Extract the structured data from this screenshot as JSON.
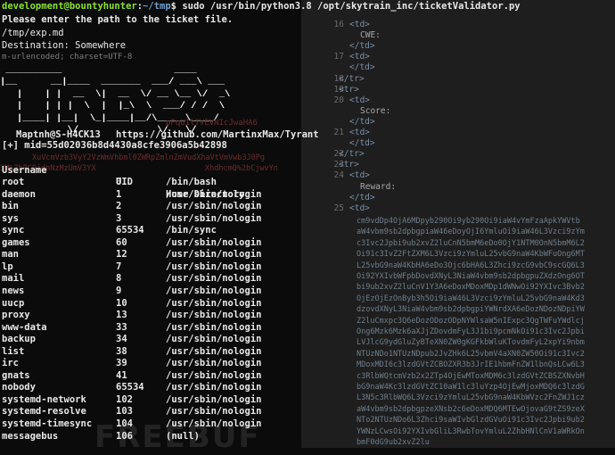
{
  "terminal": {
    "prompt_user": "development@bountyhunter",
    "prompt_sep": ":",
    "prompt_path": "~/tmp",
    "prompt_symbol": "$ ",
    "command": "sudo /usr/bin/python3.8 /opt/skytrain_inc/ticketValidator.py",
    "lines": [
      "Please enter the path to the ticket file.",
      "/tmp/exp.md",
      "Destination: Somewhere"
    ],
    "ghost_line": "m-urlencoded; charset=UTF-8",
    "ascii_art": " __________                    ____     \n|__      __|____  _______  ___/ ___\\ ___\n   |    | |  __  \\|  __  \\/ __ \\__ \\/  _\\\n   |    | | |  \\  |  |_\\  \\  ___/ / /  \\\n   |____| |__|  \\_|____|__/\\_____\\____/\n            \\/              \\/   \\/",
    "ghost_mid": "pPqU1lTVEVNIcJwaHA6",
    "banner_left": "Maptnh@S-H4CK13",
    "banner_right": "https://github.com/MartinxMax/Tyrant",
    "ghost_b64_1": "XuVcmVzb3VyY2VzWmVhbml0ZWRpZmlnZmVudXhaVtVmVwb3J0Pg",
    "ghost_b64_2": "3M%2bPC9jdnNzMzUmV3YX",
    "ghost_b64_3": "XhdhcmQ%2bCjwvYn",
    "mid_line": "[+] mid=55d02036b8d4430a8cfe3906a5b42898",
    "table_header": {
      "user": "Username",
      "uid": "UID",
      "home": "Home Directory"
    },
    "rows": [
      {
        "user": "root",
        "uid": "0",
        "home": "/bin/bash"
      },
      {
        "user": "daemon",
        "uid": "1",
        "home": "/usr/sbin/nologin"
      },
      {
        "user": "bin",
        "uid": "2",
        "home": "/usr/sbin/nologin"
      },
      {
        "user": "sys",
        "uid": "3",
        "home": "/usr/sbin/nologin"
      },
      {
        "user": "sync",
        "uid": "65534",
        "home": "/bin/sync"
      },
      {
        "user": "games",
        "uid": "60",
        "home": "/usr/sbin/nologin"
      },
      {
        "user": "man",
        "uid": "12",
        "home": "/usr/sbin/nologin"
      },
      {
        "user": "lp",
        "uid": "7",
        "home": "/usr/sbin/nologin"
      },
      {
        "user": "mail",
        "uid": "8",
        "home": "/usr/sbin/nologin"
      },
      {
        "user": "news",
        "uid": "9",
        "home": "/usr/sbin/nologin"
      },
      {
        "user": "uucp",
        "uid": "10",
        "home": "/usr/sbin/nologin"
      },
      {
        "user": "proxy",
        "uid": "13",
        "home": "/usr/sbin/nologin"
      },
      {
        "user": "www-data",
        "uid": "33",
        "home": "/usr/sbin/nologin"
      },
      {
        "user": "backup",
        "uid": "34",
        "home": "/usr/sbin/nologin"
      },
      {
        "user": "list",
        "uid": "38",
        "home": "/usr/sbin/nologin"
      },
      {
        "user": "irc",
        "uid": "39",
        "home": "/usr/sbin/nologin"
      },
      {
        "user": "gnats",
        "uid": "41",
        "home": "/usr/sbin/nologin"
      },
      {
        "user": "nobody",
        "uid": "65534",
        "home": "/usr/sbin/nologin"
      },
      {
        "user": "systemd-network",
        "uid": "102",
        "home": "/usr/sbin/nologin"
      },
      {
        "user": "systemd-resolve",
        "uid": "103",
        "home": "/usr/sbin/nologin"
      },
      {
        "user": "systemd-timesync",
        "uid": "104",
        "home": "/usr/sbin/nologin"
      },
      {
        "user": "messagebus",
        "uid": "106",
        "home": "(null)"
      }
    ],
    "watermark": "FREEBUF"
  },
  "code_view": {
    "lines": [
      {
        "num": "16",
        "text": "<td>"
      },
      {
        "num": "",
        "text": "CWE:"
      },
      {
        "num": "",
        "text": "</td>"
      },
      {
        "num": "17",
        "text": "<td>"
      },
      {
        "num": "",
        "text": "</td>"
      },
      {
        "num": "18",
        "text": "</tr>"
      },
      {
        "num": "19",
        "text": "<tr>"
      },
      {
        "num": "20",
        "text": "<td>"
      },
      {
        "num": "",
        "text": "Score:"
      },
      {
        "num": "",
        "text": "</td>"
      },
      {
        "num": "21",
        "text": "<td>"
      },
      {
        "num": "",
        "text": "</td>"
      },
      {
        "num": "22",
        "text": "</tr>"
      },
      {
        "num": "23",
        "text": "<tr>"
      },
      {
        "num": "24",
        "text": "<td>"
      },
      {
        "num": "",
        "text": "Reward:"
      },
      {
        "num": "",
        "text": "</td>"
      },
      {
        "num": "25",
        "text": "<td>"
      }
    ],
    "b64_lines": [
      "cm9vdDp4OjA6MDpyb290Oi9yb290Oi9iaW4vYmFzaApkYWVtb",
      "aW4vbm9sb2dpbgpiaW46eDoyOjI6YmluOi9iaW46L3Vzci9zYm",
      "c3Ivc2Jpbi9ub2xvZ2luCnN5bmM6eDo0OjY1NTM0OnN5bmM6L2",
      "Oi91c3IvZ2FtZXM6L3Vzci9zYmluL25vbG9naW4KbWFuOng6MT",
      "L25vbG9naW4KbHA6eDo3Ojc6bHA6L3Zhci9zcG9vbC9scGQ6L3",
      "Oi92YXIvbWFpbDovdXNyL3NiaW4vbm9sb2dpbgpuZXdzOng6OT",
      "bi9ub2xvZ2luCnV1Y3A6eDoxMDoxMDp1dWNwOi92YXIvc3Bvb2",
      "OjEzOjEzOnByb3h5Oi9iaW46L3Vzci9zYmluL25vbG9naW4Kd3",
      "dzovdXNyL3NiaW4vbm9sb2dpbgpiYWNrdXA6eDozNDozNDpiYW",
      "Z2luCmxpc3Q6eDozODozODpNYWlsaW5nIExpc3QgTWFuYWdlcj",
      "Ong6Mzk6Mzk6aXJjZDovdmFyL3J1bi9pcmNkOi91c3Ivc2Jpbi",
      "LVJlcG9ydGluZyBTeXN0ZW0gKGFkbWluKTovdmFyL2xpYi9nbm",
      "NTUzNDo1NTUzNDpub2JvZHk6L25vbmV4aXN0ZW50Oi91c3Ivc2",
      "MDoxMDI6c3lzdGVtZCBOZXR3b3JrIE1hbmFnZW1lbnQsLCw6L3",
      "c3RlbWQtcmVzb2x2ZTp4OjEwMToxMDM6c3lzdGVtZCBSZXNvbH",
      "bG9naW4Kc3lzdGVtZC10aW1lc3luYzp4OjEwMjoxMDQ6c3lzdG",
      "L3N5c3RlbWQ6L3Vzci9zYmluL25vbG9naW4KbWVzc2FnZWJ1cz",
      "aW4vbm9sb2dpbgpzeXNsb2c6eDoxMDQ6MTEwOjovaG9tZS9zeX",
      "NTo2NTUzNDo6L3Zhci9saWIvbGlzdGVuOi91c3Ivc2Jpbi9ub2",
      "YWNzLCwsOi92YXIvbGliL3RwbTovYmluL2ZhbHNlCnV1aWRkOn",
      "bmF0dG9ub2xvZ2lu"
    ]
  }
}
